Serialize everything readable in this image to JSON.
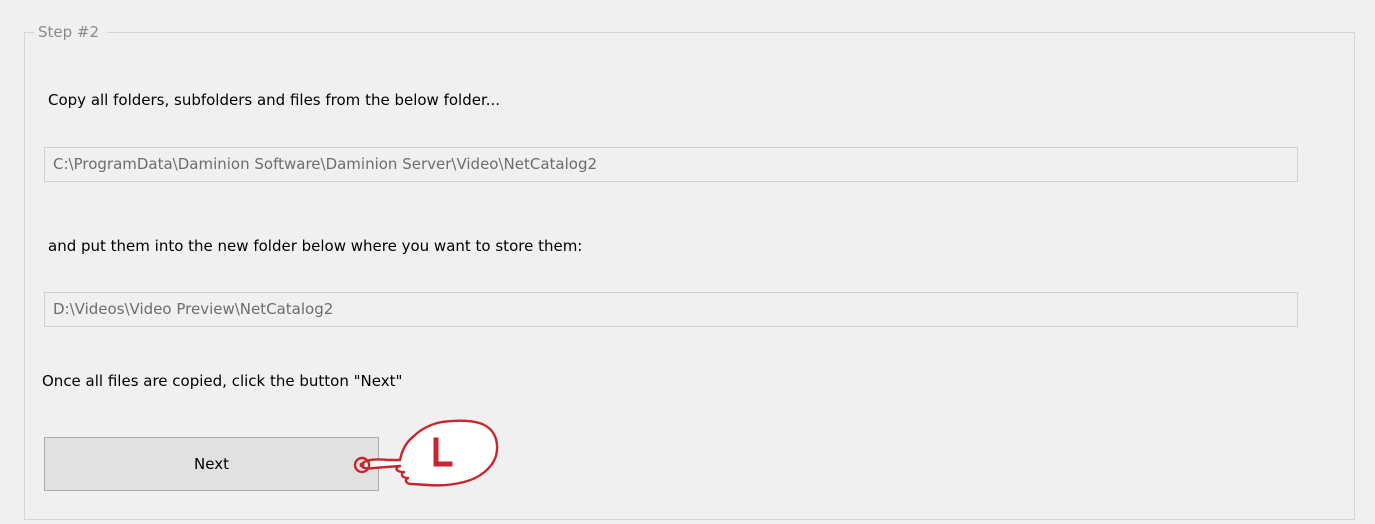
{
  "group": {
    "title": "Step #2"
  },
  "instructions": {
    "copy_from": "Copy all folders, subfolders and files from the below folder...",
    "put_into": "and put them into the new folder below where you want to store them:",
    "once_copied": "Once all files are copied, click the button \"Next\""
  },
  "fields": {
    "source_path": "C:\\ProgramData\\Daminion Software\\Daminion Server\\Video\\NetCatalog2",
    "destination_path": "D:\\Videos\\Video Preview\\NetCatalog2"
  },
  "buttons": {
    "next_label": "Next"
  },
  "annotation": {
    "icon": "left-click-hand-icon",
    "letter": "L",
    "color": "#c8262f"
  }
}
